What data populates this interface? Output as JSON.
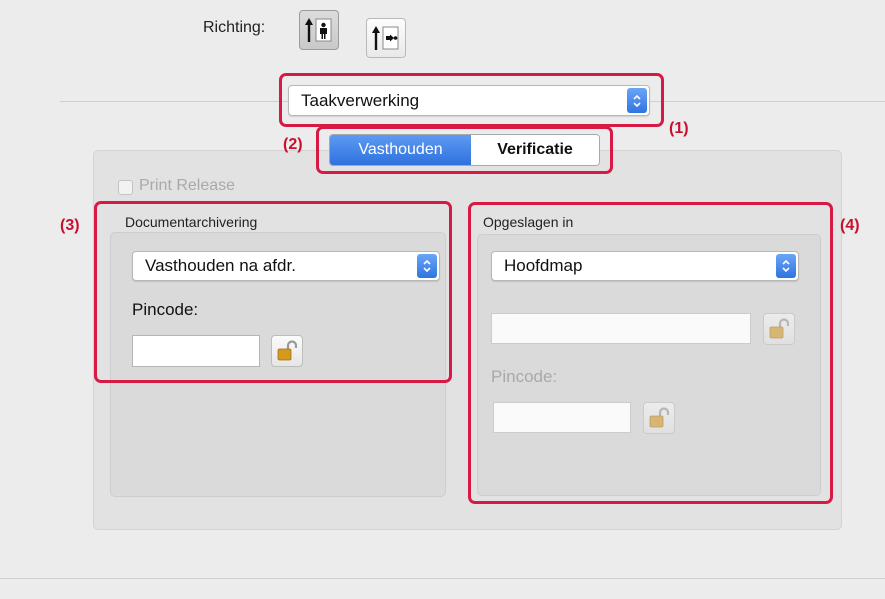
{
  "orientation": {
    "label": "Richting:",
    "options": [
      {
        "name": "portrait",
        "selected": true
      },
      {
        "name": "landscape",
        "selected": false
      }
    ]
  },
  "job_handling_popup": {
    "value": "Taakverwerking"
  },
  "tabs": [
    {
      "label": "Vasthouden",
      "active": true
    },
    {
      "label": "Verificatie",
      "active": false
    }
  ],
  "print_release": {
    "label": "Print Release",
    "checked": false,
    "enabled": false
  },
  "document_filing": {
    "title": "Documentarchivering",
    "mode_popup": {
      "value": "Vasthouden na afdr."
    },
    "pincode_label": "Pincode:",
    "pincode_value": ""
  },
  "stored_in": {
    "title": "Opgeslagen in",
    "folder_popup": {
      "value": "Hoofdmap"
    },
    "folder_name_value": "",
    "pincode_label": "Pincode:",
    "pincode_value": ""
  },
  "callouts": [
    "(1)",
    "(2)",
    "(3)",
    "(4)"
  ],
  "colors": {
    "callout": "#d61a45",
    "accent": "#2f74e0",
    "background": "#ececec"
  }
}
